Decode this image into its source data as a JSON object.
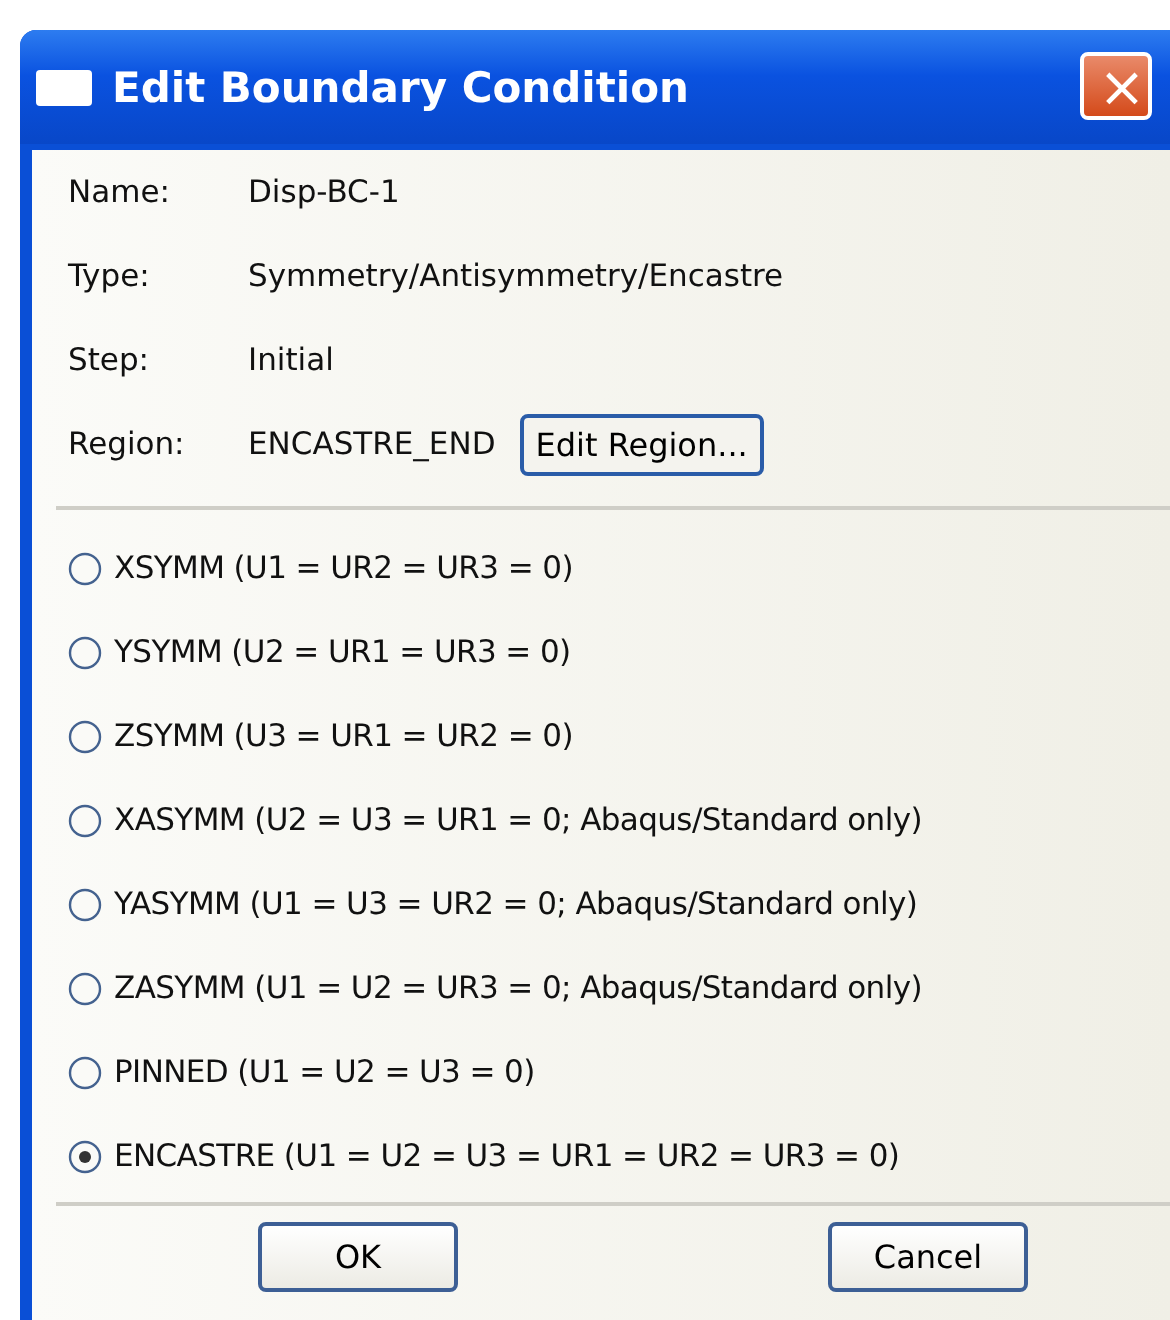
{
  "window": {
    "title": "Edit Boundary Condition",
    "close": "×"
  },
  "fields": [
    {
      "label": "Name:",
      "value": "Disp-BC-1"
    },
    {
      "label": "Type:",
      "value": "Symmetry/Antisymmetry/Encastre"
    },
    {
      "label": "Step:",
      "value": "Initial"
    },
    {
      "label": "Region:",
      "value": "ENCASTRE_END",
      "button": "Edit Region..."
    }
  ],
  "options": [
    {
      "label": "XSYMM (U1 = UR2 = UR3 = 0)",
      "selected": false
    },
    {
      "label": "YSYMM (U2 = UR1 = UR3 = 0)",
      "selected": false
    },
    {
      "label": "ZSYMM (U3 = UR1 = UR2 = 0)",
      "selected": false
    },
    {
      "label": "XASYMM (U2 = U3 = UR1 = 0; Abaqus/Standard only)",
      "selected": false
    },
    {
      "label": "YASYMM (U1 = U3 = UR2 = 0; Abaqus/Standard only)",
      "selected": false
    },
    {
      "label": "ZASYMM (U1 = U2 = UR3 = 0; Abaqus/Standard only)",
      "selected": false
    },
    {
      "label": "PINNED (U1 = U2 = U3 = 0)",
      "selected": false
    },
    {
      "label": "ENCASTRE (U1 = U2 = U3 = UR1 = UR2 = UR3 = 0)",
      "selected": true
    }
  ],
  "buttons": [
    "OK",
    "Cancel"
  ]
}
